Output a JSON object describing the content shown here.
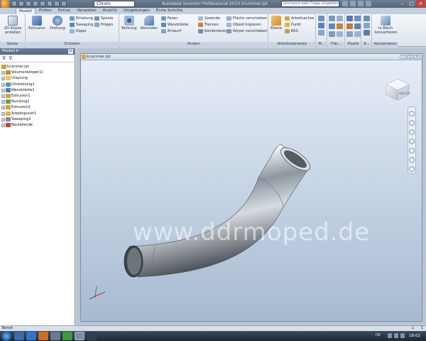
{
  "titlebar": {
    "material": "Chrom",
    "title": "Autodesk Inventor Professional 2010    krummer.ipt",
    "search_placeholder": "Stichwort oder Frage eingeben"
  },
  "ribbon_tabs": [
    "Modell",
    "Prüfen",
    "Extras",
    "Verwalten",
    "Ansicht",
    "Umgebungen",
    "Erste Schritte"
  ],
  "ribbon": {
    "skizze": {
      "label": "Skizze",
      "sketch_btn": "2D-Skizze erstellen"
    },
    "erstellen": {
      "label": "Erstellen",
      "extrusion": "Extrusion",
      "drehung": "Drehung",
      "erhebung": "Erhebung",
      "sweeping": "Sweeping",
      "rippe": "Rippe",
      "spirale": "Spirale",
      "praegen": "Prägen"
    },
    "aendern": {
      "label": "Ändern",
      "bohrung": "Bohrung",
      "abrunden": "Abrunden",
      "fasen": "Fasen",
      "wandstaerke": "Wandstärke",
      "entwurf": "Entwurf",
      "gewinde": "Gewinde",
      "trennen": "Trennen",
      "kombinieren": "Kombinieren",
      "flaeche_verschieben": "Fläche verschieben",
      "objekt_kopieren": "Objekt kopieren",
      "koerper_verschieben": "Körper verschieben"
    },
    "arbeitselemente": {
      "label": "Arbeitselemente",
      "ebene": "Ebene",
      "arbeitsachse": "Arbeitsachse",
      "punkt": "Punkt",
      "bks": "BKS"
    },
    "muster": {
      "label": "M..."
    },
    "flaeche": {
      "label": "Fläc..."
    },
    "plastik": {
      "label": "Plastik"
    },
    "k": {
      "label": "K..."
    },
    "konvertieren": {
      "label": "Konvertieren",
      "blech": "In Blech konvertieren"
    }
  },
  "browser": {
    "header": "Modell",
    "close": "×",
    "items": [
      {
        "label": "krummer.ipt",
        "level": 0,
        "color": "#d99a2b"
      },
      {
        "label": "Volumenkörper(1)",
        "level": 1,
        "color": "#c88a2a"
      },
      {
        "label": "Ursprung",
        "level": 1,
        "color": "#e7c65b"
      },
      {
        "label": "Umdrehung1",
        "level": 1,
        "color": "#5f8fc4"
      },
      {
        "label": "Wandstärke1",
        "level": 1,
        "color": "#4c7bb1"
      },
      {
        "label": "Extrusion1",
        "level": 1,
        "color": "#d1a23a"
      },
      {
        "label": "Rundung1",
        "level": 1,
        "color": "#6aa24a"
      },
      {
        "label": "Extrusion2",
        "level": 1,
        "color": "#d1a23a"
      },
      {
        "label": "Arbeitspunkt1",
        "level": 1,
        "color": "#e0b03c"
      },
      {
        "label": "Sweeping1",
        "level": 1,
        "color": "#7b8a9c"
      },
      {
        "label": "Bauteilende",
        "level": 1,
        "color": "#d23b3b"
      }
    ]
  },
  "document": {
    "title": "krummer.ipt",
    "watermark": "www.ddrmoped.de",
    "viewcube_label": "HINTEN"
  },
  "statusbar": {
    "text": "Bereit",
    "num1": "1",
    "num2": "1"
  },
  "taskbar": {
    "lang": "DE",
    "clock": "18:02"
  },
  "colors": {
    "ribbon_bg": "#e6ebf1",
    "viewport_top": "#e6edf6",
    "viewport_bottom": "#a7bad1",
    "title_bg": "#55667a"
  }
}
